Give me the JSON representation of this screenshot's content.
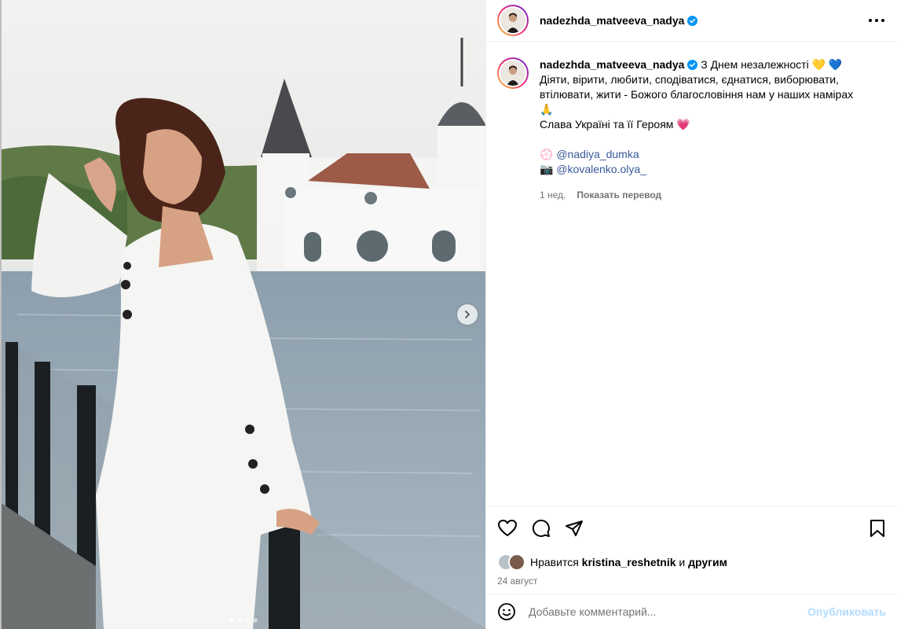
{
  "post": {
    "username": "nadezhda_matveeva_nadya",
    "menu_icon": "more-horizontal-icon",
    "verified_icon": "verified-badge-icon",
    "media": {
      "slide_count": 4,
      "active_slide": 1,
      "next_icon": "chevron-right-icon"
    }
  },
  "caption": {
    "username": "nadezhda_matveeva_nadya",
    "line1": "З Днем незалежності 💛 💙",
    "line2": "Діяти, вірити, любити, сподіватися, єднатися, виборювати, втілювати, жити - Божого благословіння нам у наших намірах 🙏",
    "line3": "Слава Україні та її Героям 💗",
    "credit1_emoji": "💮",
    "credit1": "@nadiya_dumka",
    "credit2_emoji": "📷",
    "credit2": "@kovalenko.olya_",
    "time": "1 нед.",
    "translate": "Показать перевод"
  },
  "actions": {
    "like_icon": "heart-icon",
    "comment_icon": "comment-icon",
    "share_icon": "send-icon",
    "save_icon": "bookmark-icon",
    "likes_prefix": "Нравится",
    "likes_user": "kristina_reshetnik",
    "likes_middle": "и",
    "likes_suffix": "другим",
    "date": "24 август"
  },
  "comment_box": {
    "emoji_icon": "smiley-icon",
    "placeholder": "Добавьте комментарий...",
    "publish": "Опубликовать"
  }
}
